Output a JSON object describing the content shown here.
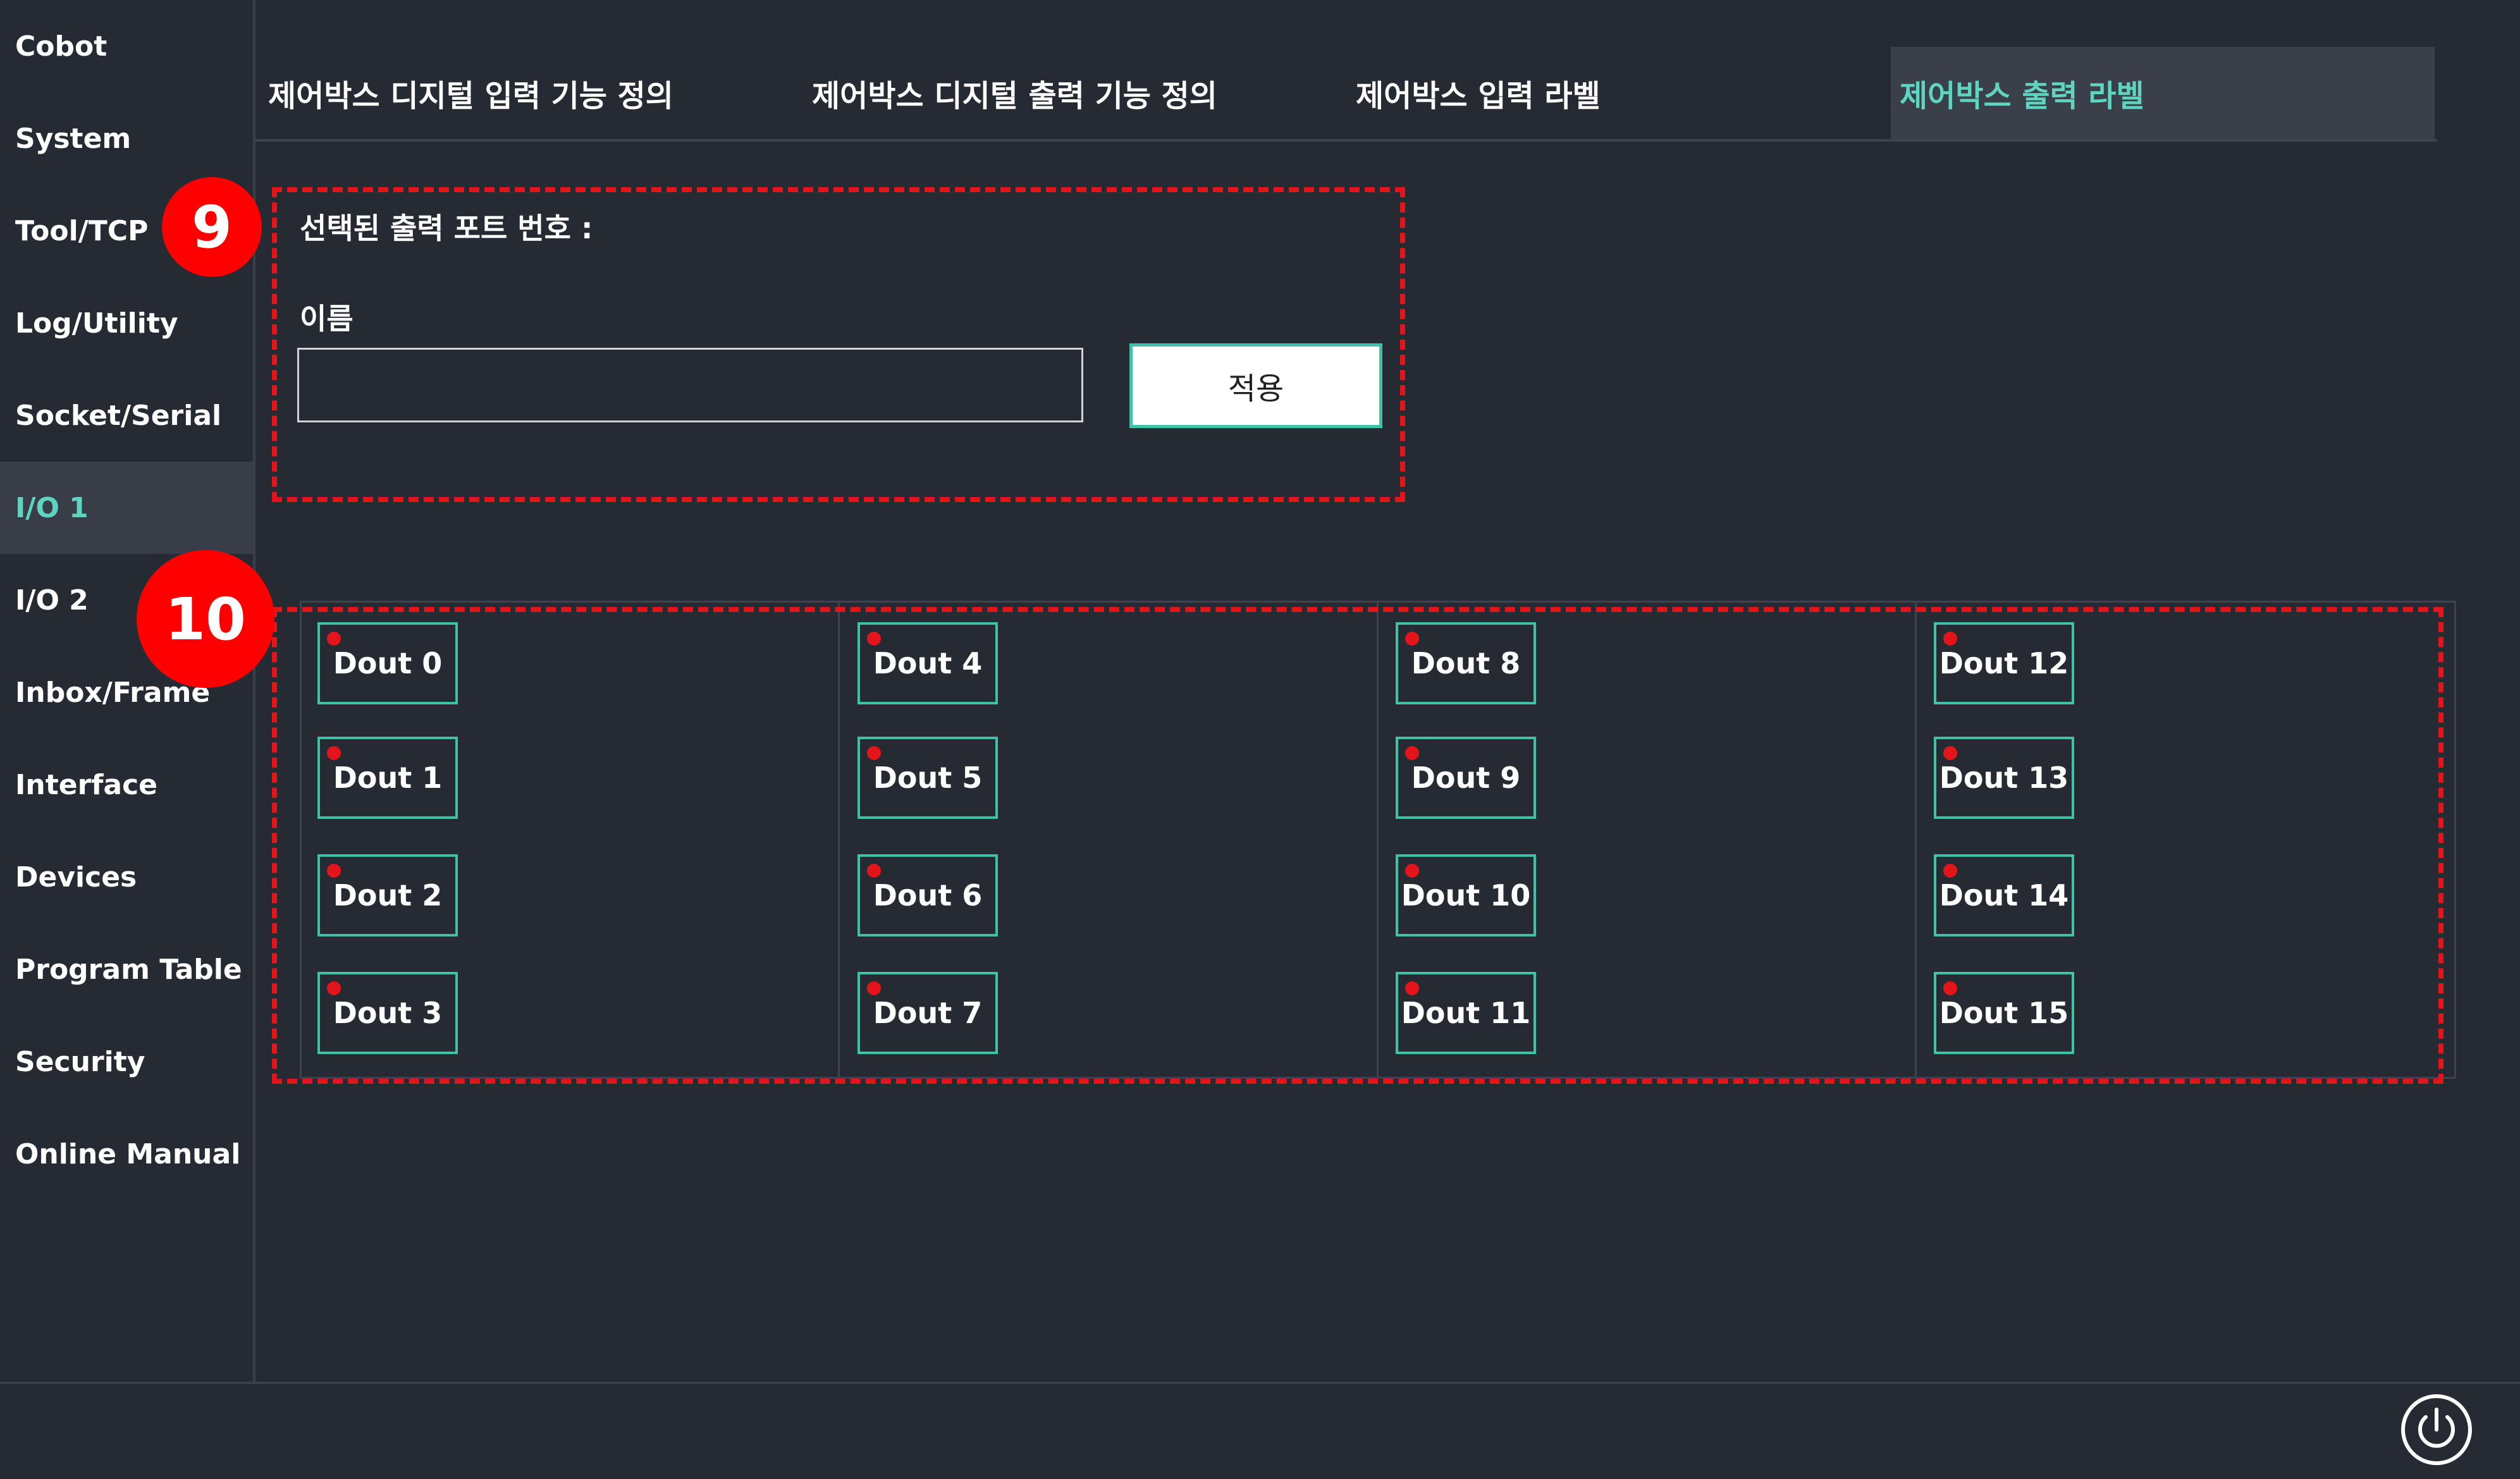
{
  "sidebar": {
    "items": [
      {
        "label": "Cobot"
      },
      {
        "label": "System"
      },
      {
        "label": "Tool/TCP"
      },
      {
        "label": "Log/Utility"
      },
      {
        "label": "Socket/Serial"
      },
      {
        "label": "I/O 1"
      },
      {
        "label": "I/O 2"
      },
      {
        "label": "Inbox/Frame"
      },
      {
        "label": "Interface"
      },
      {
        "label": "Devices"
      },
      {
        "label": "Program Table"
      },
      {
        "label": "Security"
      },
      {
        "label": "Online Manual"
      }
    ],
    "active_index": 5
  },
  "tabs": [
    {
      "label": "제어박스 디지털 입력 기능 정의"
    },
    {
      "label": "제어박스 디지털 출력 기능 정의"
    },
    {
      "label": "제어박스 입력 라벨"
    },
    {
      "label": "제어박스 출력 라벨"
    }
  ],
  "active_tab": 3,
  "form": {
    "selected_port_label": "선택된 출력 포트 번호 :",
    "name_label": "이름",
    "name_value": "",
    "apply_label": "적용"
  },
  "annotations": {
    "badge_1": "9",
    "badge_2": "10"
  },
  "outputs": {
    "columns": [
      [
        "Dout 0",
        "Dout 1",
        "Dout 2",
        "Dout 3"
      ],
      [
        "Dout 4",
        "Dout 5",
        "Dout 6",
        "Dout 7"
      ],
      [
        "Dout 8",
        "Dout 9",
        "Dout 10",
        "Dout 11"
      ],
      [
        "Dout 12",
        "Dout 13",
        "Dout 14",
        "Dout 15"
      ]
    ],
    "indicator_state": "off"
  },
  "colors": {
    "background": "#262a33",
    "accent": "#5fd4c0",
    "annotation_red": "#e3151b",
    "button_border": "#3fc3a8"
  },
  "icons": {
    "power": "power-icon"
  }
}
